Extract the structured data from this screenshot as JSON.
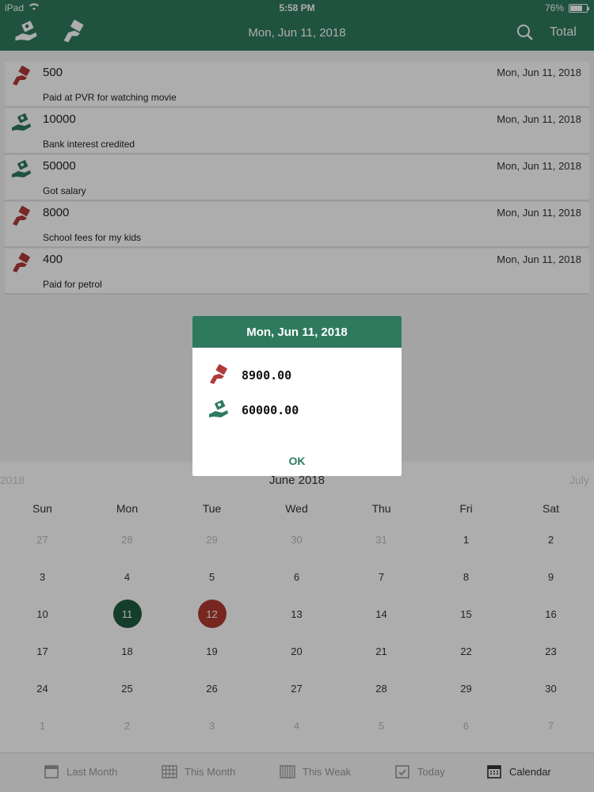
{
  "status_bar": {
    "device": "iPad",
    "time": "5:58 PM",
    "battery": "76%"
  },
  "header": {
    "title": "Mon, Jun 11, 2018",
    "total_label": "Total"
  },
  "transactions": [
    {
      "amount": "500",
      "date": "Mon, Jun 11, 2018",
      "note": "Paid at PVR for watching movie",
      "kind": "expense"
    },
    {
      "amount": "10000",
      "date": "Mon, Jun 11, 2018",
      "note": "Bank interest credited",
      "kind": "income"
    },
    {
      "amount": "50000",
      "date": "Mon, Jun 11, 2018",
      "note": "Got salary",
      "kind": "income"
    },
    {
      "amount": "8000",
      "date": "Mon, Jun 11, 2018",
      "note": "School fees for my kids",
      "kind": "expense"
    },
    {
      "amount": "400",
      "date": "Mon, Jun 11, 2018",
      "note": "Paid for petrol",
      "kind": "expense"
    }
  ],
  "dialog": {
    "title": "Mon, Jun 11, 2018",
    "expense_total": "8900.00",
    "income_total": "60000.00",
    "ok_label": "OK"
  },
  "calendar": {
    "prev_label": "2018",
    "month_label": "June 2018",
    "next_label": "July",
    "weekdays": [
      "Sun",
      "Mon",
      "Tue",
      "Wed",
      "Thu",
      "Fri",
      "Sat"
    ],
    "weeks": [
      [
        "27",
        "28",
        "29",
        "30",
        "31",
        "1",
        "2"
      ],
      [
        "3",
        "4",
        "5",
        "6",
        "7",
        "8",
        "9"
      ],
      [
        "10",
        "11",
        "12",
        "13",
        "14",
        "15",
        "16"
      ],
      [
        "17",
        "18",
        "19",
        "20",
        "21",
        "22",
        "23"
      ],
      [
        "24",
        "25",
        "26",
        "27",
        "28",
        "29",
        "30"
      ],
      [
        "1",
        "2",
        "3",
        "4",
        "5",
        "6",
        "7"
      ]
    ],
    "selected_day": "11",
    "today_day": "12"
  },
  "toolbar": {
    "items": [
      {
        "label": "Last Month",
        "icon": "calendar-page-icon"
      },
      {
        "label": "This Month",
        "icon": "grid-icon"
      },
      {
        "label": "This Weak",
        "icon": "columns-icon"
      },
      {
        "label": "Today",
        "icon": "check-calendar-icon"
      },
      {
        "label": "Calendar",
        "icon": "calendar-icon"
      }
    ],
    "active_index": 4
  },
  "colors": {
    "primary": "#2f7a5e",
    "selected": "#1f5a42",
    "today": "#b03a2e",
    "expense": "#b03a3a",
    "income": "#2f7a5e"
  }
}
